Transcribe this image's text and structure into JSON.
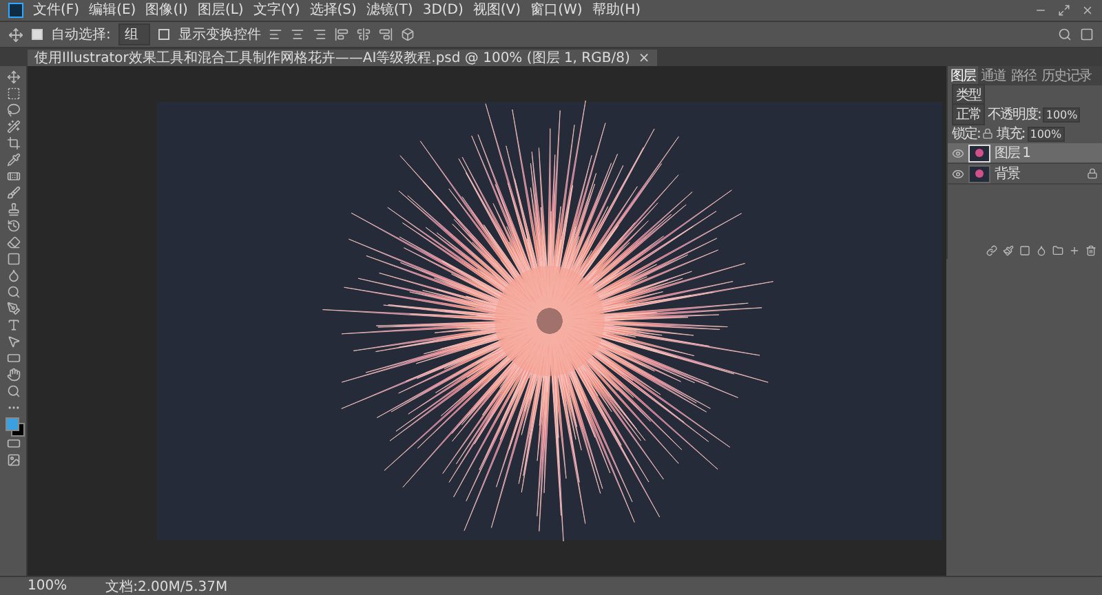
{
  "menu": [
    "文件(F)",
    "编辑(E)",
    "图像(I)",
    "图层(L)",
    "文字(Y)",
    "选择(S)",
    "滤镜(T)",
    "3D(D)",
    "视图(V)",
    "窗口(W)",
    "帮助(H)"
  ],
  "options": {
    "auto_select": {
      "label": "自动选择:",
      "checked": true
    },
    "target": "组",
    "show_transform": {
      "label": "显示变换控件",
      "checked": false
    }
  },
  "document_tab": {
    "title": "使用Illustrator效果工具和混合工具制作网格花卉——AI等级教程.psd @ 100% (图层 1, RGB/8)",
    "close": "×"
  },
  "panel": {
    "tabs": [
      {
        "label": "图层",
        "selected": true
      },
      {
        "label": "通道",
        "selected": false
      },
      {
        "label": "路径",
        "selected": false
      },
      {
        "label": "历史记录",
        "selected": false
      }
    ],
    "filter": "类型",
    "blend_mode": "正常",
    "opacity_label": "不透明度:",
    "opacity": "100%",
    "lock_label": "锁定:",
    "fill_label": "填充:",
    "fill": "100%",
    "layers": [
      {
        "name": "图层 1",
        "visible": true,
        "selected": true,
        "locked": false
      },
      {
        "name": "背景",
        "visible": true,
        "selected": false,
        "locked": true
      }
    ]
  },
  "status": {
    "zoom": "100%",
    "doc": "文档:2.00M/5.37M"
  }
}
